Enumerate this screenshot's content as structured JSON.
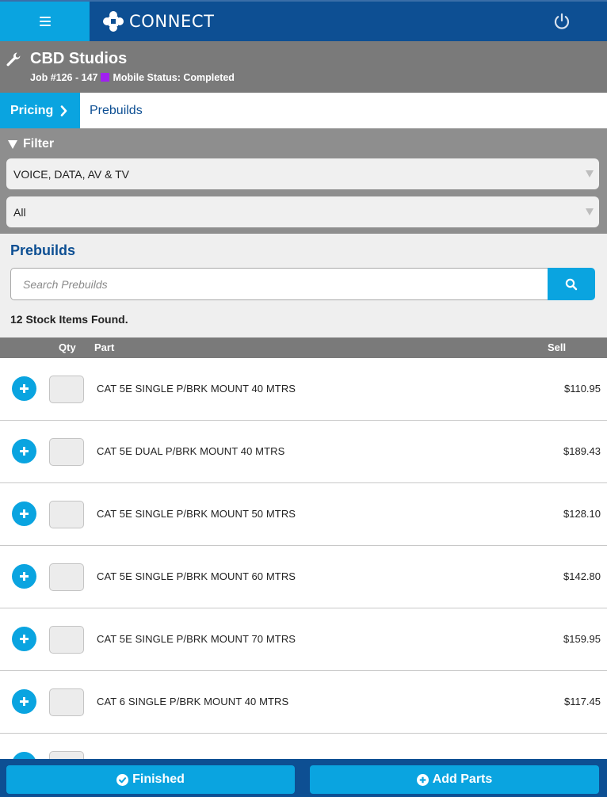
{
  "app": {
    "brand": "CONNECT",
    "icons": {
      "menu": "hamburger-icon",
      "logo": "connect-logo-icon",
      "power": "power-icon"
    },
    "colors": {
      "navy": "#0d4f93",
      "accent": "#0aa4e0",
      "status_completed": "#a020f0"
    }
  },
  "job": {
    "title": "CBD Studios",
    "number": "Job #126 - 147",
    "mobile_status": "Mobile Status: Completed",
    "icon": "wrench-icon"
  },
  "breadcrumb": {
    "parent": "Pricing",
    "current": "Prebuilds"
  },
  "filter": {
    "label": "Filter",
    "category_selected": "VOICE, DATA, AV & TV",
    "subcategory_selected": "All"
  },
  "prebuilds": {
    "title": "Prebuilds",
    "search_placeholder": "Search Prebuilds",
    "found_text": "12 Stock Items Found."
  },
  "table": {
    "headers": {
      "qty": "Qty",
      "part": "Part",
      "sell": "Sell"
    },
    "rows": [
      {
        "part": "CAT 5E SINGLE P/BRK MOUNT 40 MTRS",
        "sell": "$110.95"
      },
      {
        "part": "CAT 5E DUAL P/BRK MOUNT 40 MTRS",
        "sell": "$189.43"
      },
      {
        "part": "CAT 5E SINGLE P/BRK MOUNT 50 MTRS",
        "sell": "$128.10"
      },
      {
        "part": "CAT 5E SINGLE P/BRK MOUNT 60 MTRS",
        "sell": "$142.80"
      },
      {
        "part": "CAT 5E SINGLE P/BRK MOUNT 70 MTRS",
        "sell": "$159.95"
      },
      {
        "part": "CAT 6 SINGLE P/BRK MOUNT 40 MTRS",
        "sell": "$117.45"
      }
    ]
  },
  "footer": {
    "finished_label": "Finished",
    "add_parts_label": "Add Parts"
  }
}
